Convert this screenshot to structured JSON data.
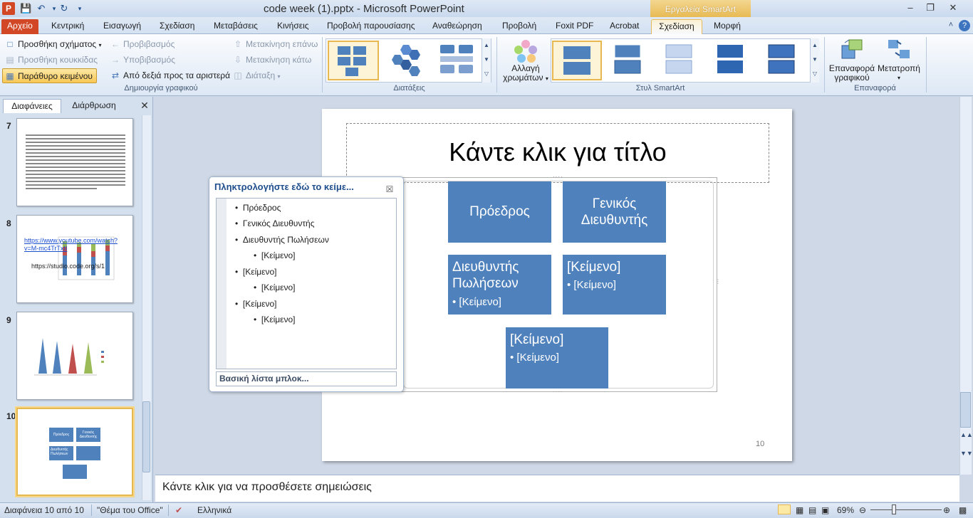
{
  "window": {
    "title": "code week (1).pptx - Microsoft PowerPoint",
    "contextual_tab_group": "Εργαλεία SmartArt",
    "app_icon_letter": "P"
  },
  "tabs": [
    {
      "label": "Αρχείο"
    },
    {
      "label": "Κεντρική"
    },
    {
      "label": "Εισαγωγή"
    },
    {
      "label": "Σχεδίαση"
    },
    {
      "label": "Μεταβάσεις"
    },
    {
      "label": "Κινήσεις"
    },
    {
      "label": "Προβολή παρουσίασης"
    },
    {
      "label": "Αναθεώρηση"
    },
    {
      "label": "Προβολή"
    },
    {
      "label": "Foxit PDF"
    },
    {
      "label": "Acrobat"
    },
    {
      "label": "Σχεδίαση"
    },
    {
      "label": "Μορφή"
    }
  ],
  "ribbon": {
    "create_graphic": {
      "add_shape": "Προσθήκη σχήματος",
      "add_bullet": "Προσθήκη κουκκίδας",
      "text_pane": "Παράθυρο κειμένου",
      "promote": "Προβιβασμός",
      "demote": "Υποβιβασμός",
      "right_to_left": "Από δεξιά προς τα αριστερά",
      "move_up": "Μετακίνηση επάνω",
      "move_down": "Μετακίνηση κάτω",
      "layout": "Διάταξη",
      "group_label": "Δημιουργία γραφικού"
    },
    "layouts": {
      "group_label": "Διατάξεις"
    },
    "styles": {
      "change_colors_line1": "Αλλαγή",
      "change_colors_line2": "χρωμάτων",
      "group_label": "Στυλ SmartArt"
    },
    "reset": {
      "reset_graphic_line1": "Επαναφορά",
      "reset_graphic_line2": "γραφικού",
      "convert": "Μετατροπή",
      "group_label": "Επαναφορά"
    }
  },
  "left_panel": {
    "tabs": [
      "Διαφάνειες",
      "Διάρθρωση"
    ],
    "thumbnails": [
      {
        "number": "7"
      },
      {
        "number": "8",
        "link": "https://www.youtube.com/watch?v=M-mc4TrTxII",
        "url2": "https://studio.code.org/s/1"
      },
      {
        "number": "9"
      },
      {
        "number": "10",
        "boxes": [
          "Πρόεδρος",
          "Γενικός Διευθυντής",
          "Διευθυντής Πωλήσεων"
        ]
      }
    ]
  },
  "slide": {
    "title_placeholder": "Κάντε κλικ για τίτλο",
    "number": "10",
    "boxes": {
      "president": "Πρόεδρος",
      "gm_line1": "Γενικός",
      "gm_line2": "Διευθυντής",
      "sales_line1": "Διευθυντής",
      "sales_line2": "Πωλήσεων",
      "sales_bullet": "• [Κείμενο]",
      "text1": "[Κείμενο]",
      "text1_bullet": "• [Κείμενο]",
      "text2": "[Κείμενο]",
      "text2_bullet": "• [Κείμενο]"
    }
  },
  "text_pane": {
    "title": "Πληκτρολογήστε εδώ το κείμε...",
    "items": [
      {
        "text": "Πρόεδρος",
        "level": 1
      },
      {
        "text": "Γενικός Διευθυντής",
        "level": 1
      },
      {
        "text": "Διευθυντής Πωλήσεων",
        "level": 1
      },
      {
        "text": "[Κείμενο]",
        "level": 2
      },
      {
        "text": "[Κείμενο]",
        "level": 1
      },
      {
        "text": "[Κείμενο]",
        "level": 2
      },
      {
        "text": "[Κείμενο]",
        "level": 1
      },
      {
        "text": "[Κείμενο]",
        "level": 2
      }
    ],
    "footer": "Βασική λίστα μπλοκ..."
  },
  "notes": {
    "placeholder": "Κάντε κλικ για να προσθέσετε σημειώσεις"
  },
  "status": {
    "slide_info": "Διαφάνεια 10 από 10",
    "theme": "\"Θέμα του Office\"",
    "language": "Ελληνικά",
    "zoom": "69%"
  },
  "colors": {
    "smartart_box": "#4f81bd",
    "file_tab": "#d24726",
    "contextual": "#e7b84f"
  }
}
